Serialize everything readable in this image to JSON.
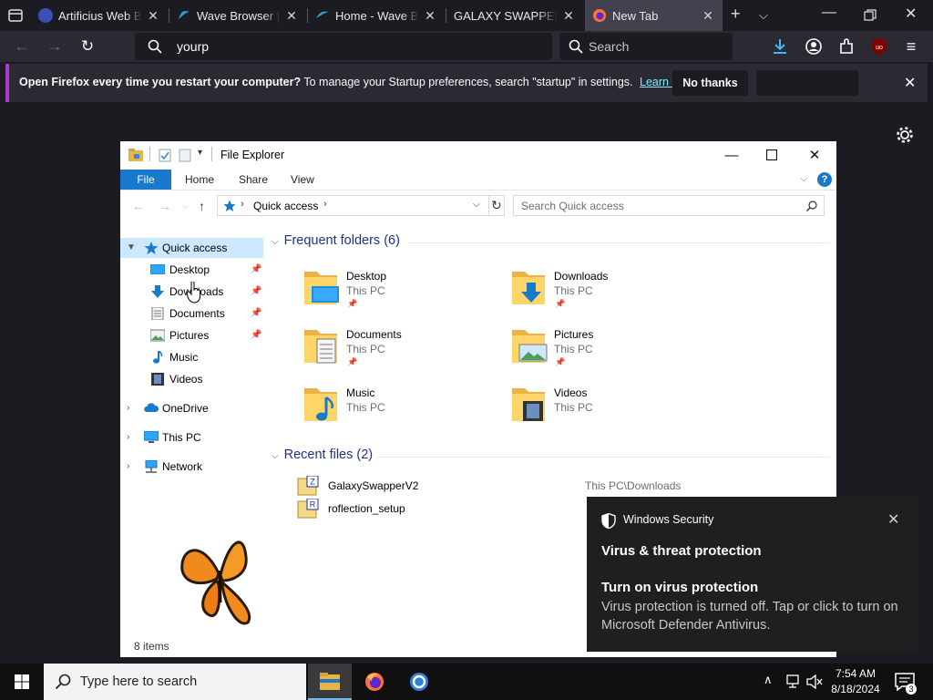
{
  "browser": {
    "tabs": [
      {
        "title": "Artificius Web Browser",
        "favicon_color": "#3b4fb8"
      },
      {
        "title": "Wave Browser | Download",
        "favicon_color": "#27a0c9"
      },
      {
        "title": "Home - Wave Browser",
        "favicon_color": "#2aa6c6"
      },
      {
        "title": "GALAXY SWAPPER - Wave",
        "favicon_color": ""
      },
      {
        "title": "New Tab",
        "favicon_color": "#ff7139",
        "active": true
      }
    ],
    "url": "yourp",
    "search_placeholder": "Search",
    "notification": {
      "bold": "Open Firefox every time you restart your computer?",
      "text": "To manage your Startup preferences, search \"startup\" in settings.",
      "link": "Learn more",
      "no_thanks": "No thanks"
    }
  },
  "explorer": {
    "title": "File Explorer",
    "ribbon_tabs": [
      "File",
      "Home",
      "Share",
      "View"
    ],
    "help": "?",
    "breadcrumb": "Quick access",
    "search_placeholder": "Search Quick access",
    "nav": [
      {
        "label": "Quick access",
        "icon": "star-icon",
        "selected": true,
        "expanded": true
      },
      {
        "label": "Desktop",
        "icon": "desktop-icon",
        "pinned": true
      },
      {
        "label": "Downloads",
        "icon": "download-icon",
        "pinned": true
      },
      {
        "label": "Documents",
        "icon": "documents-icon",
        "pinned": true
      },
      {
        "label": "Pictures",
        "icon": "pictures-icon",
        "pinned": true
      },
      {
        "label": "Music",
        "icon": "music-icon"
      },
      {
        "label": "Videos",
        "icon": "videos-icon"
      },
      {
        "label": "OneDrive",
        "icon": "cloud-icon"
      },
      {
        "label": "This PC",
        "icon": "pc-icon"
      },
      {
        "label": "Network",
        "icon": "network-icon"
      }
    ],
    "frequent_header": "Frequent folders (6)",
    "frequent": [
      {
        "name": "Desktop",
        "location": "This PC",
        "pinned": true
      },
      {
        "name": "Downloads",
        "location": "This PC",
        "pinned": true
      },
      {
        "name": "Documents",
        "location": "This PC",
        "pinned": true
      },
      {
        "name": "Pictures",
        "location": "This PC",
        "pinned": true
      },
      {
        "name": "Music",
        "location": "This PC",
        "pinned": false
      },
      {
        "name": "Videos",
        "location": "This PC",
        "pinned": false
      }
    ],
    "recent_header": "Recent files (2)",
    "recent": [
      {
        "name": "GalaxySwapperV2",
        "path": "This PC\\Downloads"
      },
      {
        "name": "roflection_setup",
        "path": ""
      }
    ],
    "status": "8 items"
  },
  "toast": {
    "app": "Windows Security",
    "heading": "Virus & threat protection",
    "title": "Turn on virus protection",
    "body": "Virus protection is turned off. Tap or click to turn on Microsoft Defender Antivirus."
  },
  "taskbar": {
    "search_placeholder": "Type here to search",
    "time": "7:54 AM",
    "date": "8/18/2024",
    "notification_count": "3"
  },
  "colors": {
    "firefox_bg": "#1c1b22",
    "accent_blue": "#1979ca",
    "notification_bar_accent": "#a83bd6"
  }
}
